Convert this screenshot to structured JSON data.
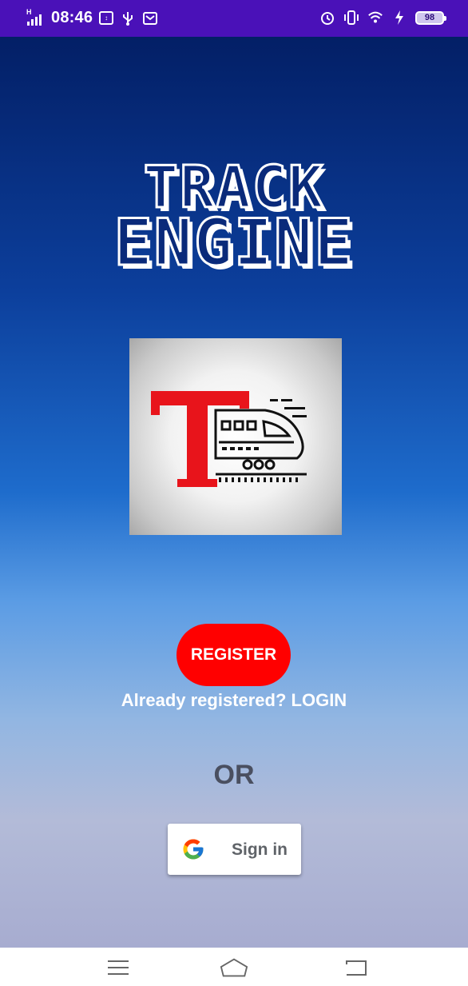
{
  "status_bar": {
    "time": "08:46",
    "network_type": "H",
    "battery_level": "98",
    "icons": [
      "signal-icon",
      "data-saver-icon",
      "usb-icon",
      "mail-icon",
      "alarm-icon",
      "vibrate-icon",
      "wifi-icon",
      "charging-icon",
      "battery-icon"
    ]
  },
  "app": {
    "title_line_1": "TRACK",
    "title_line_2": "ENGINE",
    "colors": {
      "accent": "#ff0000",
      "background_top": "#031f66",
      "background_bottom": "#a7acd0"
    }
  },
  "auth": {
    "register_label": "REGISTER",
    "login_prompt": "Already registered? LOGIN",
    "or_label": "OR",
    "google_signin_label": "Sign in"
  },
  "nav_bar": {
    "icons": [
      "menu-icon",
      "home-icon",
      "back-icon"
    ]
  }
}
